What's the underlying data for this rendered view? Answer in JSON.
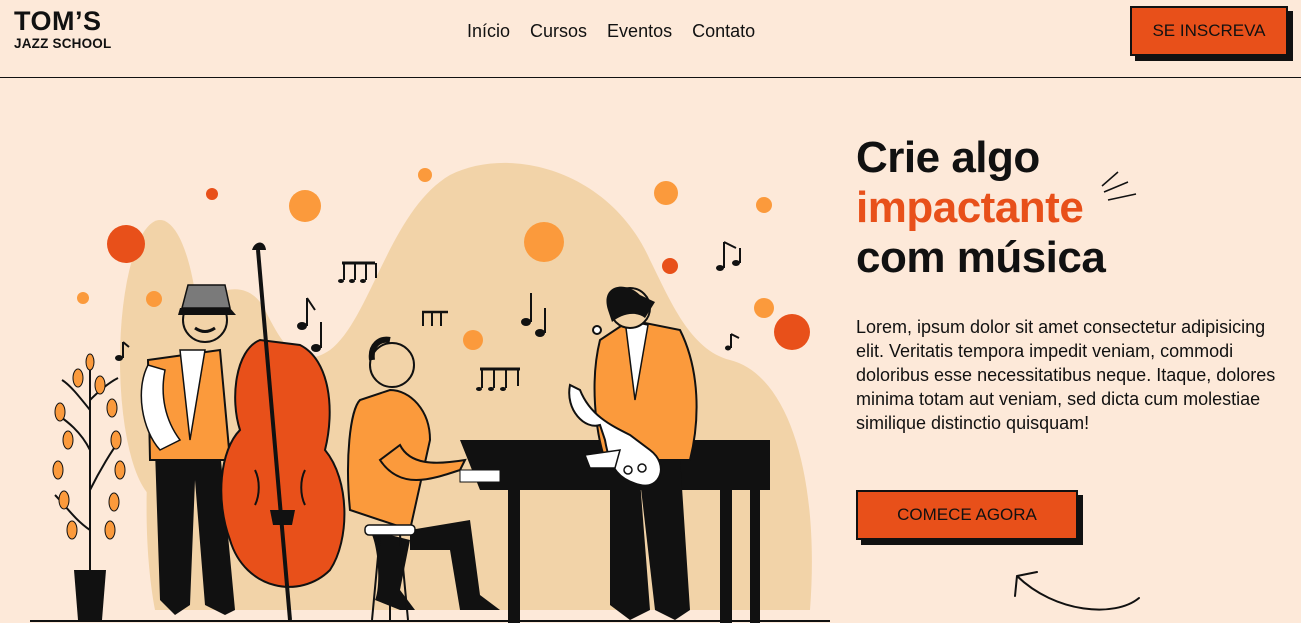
{
  "brand": {
    "name": "TOM’S",
    "subtitle": "JAZZ SCHOOL"
  },
  "nav": [
    {
      "label": "Início"
    },
    {
      "label": "Cursos"
    },
    {
      "label": "Eventos"
    },
    {
      "label": "Contato"
    }
  ],
  "header": {
    "signup_label": "SE INSCREVA"
  },
  "hero": {
    "title_line1": "Crie algo",
    "title_accent": "impactante",
    "title_line3": "com música",
    "description": "Lorem, ipsum dolor sit amet consectetur adipisicing elit. Veritatis tempora impedit veniam, commodi doloribus esse necessitatibus neque. Itaque, dolores minima totam aut veniam, sed dicta cum molestiae similique distinctio quisquam!",
    "cta_label": "COMECE AGORA"
  },
  "colors": {
    "background": "#fde9d9",
    "accent": "#e8501a",
    "secondary": "#fb9a3c",
    "blob": "#f2d3a8",
    "ink": "#111111"
  },
  "icons": [
    "music-note-icon",
    "sparkle-icon",
    "curved-arrow-icon"
  ]
}
